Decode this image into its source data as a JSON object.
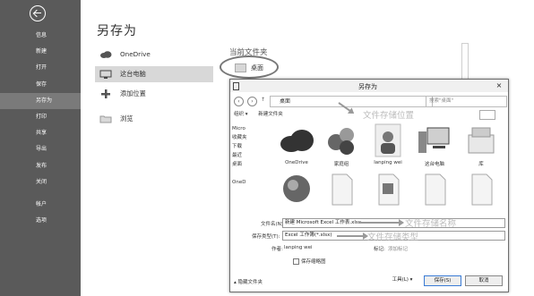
{
  "sidebar": {
    "items": [
      {
        "label": "信息"
      },
      {
        "label": "新建"
      },
      {
        "label": "打开"
      },
      {
        "label": "保存"
      },
      {
        "label": "另存为",
        "selected": true
      },
      {
        "label": "打印"
      },
      {
        "label": "共享"
      },
      {
        "label": "导出"
      },
      {
        "label": "发布"
      },
      {
        "label": "关闭"
      },
      {
        "label": "帐户"
      },
      {
        "label": "选项"
      }
    ]
  },
  "pane": {
    "title": "另存为",
    "locations": [
      "OneDrive",
      "这台电脑",
      "添加位置",
      "浏览"
    ]
  },
  "current_folder": {
    "heading": "当前文件夹",
    "item": "桌面"
  },
  "dialog": {
    "title": "另存为",
    "close": "×",
    "address": "桌面",
    "search_placeholder": "搜索\"桌面\"",
    "toolbar": {
      "organize": "组织 ▾",
      "new_folder": "新建文件夹"
    },
    "nav_items": [
      "Micro",
      "收藏夹",
      "下载",
      "最近",
      "桌面",
      "",
      "OneD"
    ],
    "files": [
      "OneDrive",
      "家庭组",
      "lanping wei",
      "这台电脑",
      "库",
      "",
      "",
      "",
      "",
      ""
    ],
    "filename_label": "文件名(N):",
    "filename_value": "新建 Microsoft Excel 工作表.xlsx",
    "filetype_label": "保存类型(T):",
    "filetype_value": "Excel 工作簿(*.xlsx)",
    "author_label": "作者:",
    "author_value": "lanping wei",
    "tags_label": "标记:",
    "tags_value": "添加标记",
    "thumb_label": "保存缩略图",
    "hide_folders": "隐藏文件夹",
    "tools_button": "工具(L) ▾",
    "save_button": "保存(S)",
    "cancel_button": "取消"
  },
  "annotations": {
    "location": "文件存储位置",
    "name": "文件存储名称",
    "type": "文件存储类型"
  }
}
